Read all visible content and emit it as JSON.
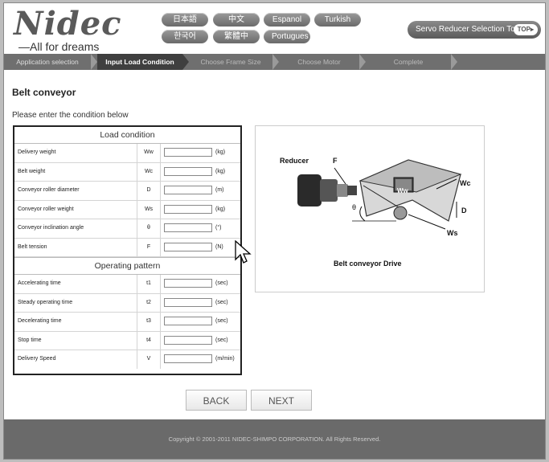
{
  "brand": {
    "logo_word": "Nidec",
    "tagline": "All for dreams"
  },
  "languages": [
    "日本語",
    "中文",
    "Espanol",
    "Turkish",
    "한국어",
    "繁體中文",
    "Portugues"
  ],
  "tool": {
    "label": "Servo Reducer Selection Tool",
    "top_label": "TOP▸"
  },
  "steps": [
    "Application selection",
    "Input Load Condition",
    "Choose Frame Size",
    "Choose Motor",
    "Complete"
  ],
  "active_step_index": 1,
  "page": {
    "title": "Belt conveyor",
    "instruction": "Please enter the condition below"
  },
  "load_condition": {
    "heading": "Load condition",
    "rows": [
      {
        "label": "Delivery weight",
        "symbol": "Ww",
        "value": "",
        "unit": "(kg)"
      },
      {
        "label": "Belt weight",
        "symbol": "Wc",
        "value": "",
        "unit": "(kg)"
      },
      {
        "label": "Conveyor roller diameter",
        "symbol": "D",
        "value": "",
        "unit": "(m)"
      },
      {
        "label": "Conveyor roller weight",
        "symbol": "Ws",
        "value": "",
        "unit": "(kg)"
      },
      {
        "label": "Conveyor inclination angle",
        "symbol": "θ",
        "value": "",
        "unit": "(°)"
      },
      {
        "label": "Belt tension",
        "symbol": "F",
        "value": "",
        "unit": "(N)"
      }
    ]
  },
  "operating_pattern": {
    "heading": "Operating pattern",
    "rows": [
      {
        "label": "Accelerating time",
        "symbol": "t1",
        "value": "",
        "unit": "(sec)"
      },
      {
        "label": "Steady operating time",
        "symbol": "t2",
        "value": "",
        "unit": "(sec)"
      },
      {
        "label": "Decelerating time",
        "symbol": "t3",
        "value": "",
        "unit": "(sec)"
      },
      {
        "label": "Stop time",
        "symbol": "t4",
        "value": "",
        "unit": "(sec)"
      },
      {
        "label": "Delivery Speed",
        "symbol": "V",
        "value": "",
        "unit": "(m/min)"
      }
    ]
  },
  "diagram": {
    "labels": {
      "reducer": "Reducer",
      "f": "F",
      "ww": "Ww",
      "wc": "Wc",
      "theta": "θ",
      "d": "D",
      "ws": "Ws"
    },
    "caption": "Belt conveyor Drive"
  },
  "buttons": {
    "back": "BACK",
    "next": "NEXT"
  },
  "footer": {
    "copyright": "Copyright © 2001-2011 NIDEC-SHIMPO CORPORATION. All Rights Reserved."
  }
}
